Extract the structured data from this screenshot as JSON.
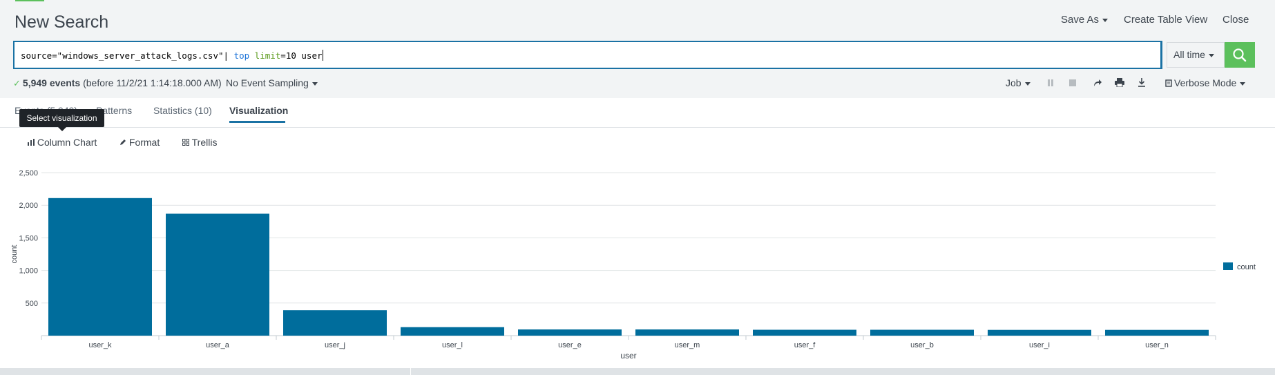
{
  "header": {
    "title": "New Search",
    "save_as": "Save As",
    "create_table_view": "Create Table View",
    "close": "Close"
  },
  "search": {
    "query_prefix": "source=\"windows_server_attack_logs.csv\"| ",
    "query_cmd": "top",
    "query_arg": " limit",
    "query_rest": "=10 user",
    "time_range": "All time",
    "search_icon": "magnifier-icon"
  },
  "status": {
    "count": "5,949 events",
    "before": "(before 11/2/21 1:14:18.000 AM)",
    "sampling": "No Event Sampling",
    "job": "Job",
    "mode": "Verbose Mode"
  },
  "tabs": {
    "events": "Events (5,949)",
    "patterns": "Patterns",
    "statistics": "Statistics (10)",
    "visualization": "Visualization"
  },
  "tooltip": "Select visualization",
  "viz_toolbar": {
    "chart_type": "Column Chart",
    "format": "Format",
    "trellis": "Trellis"
  },
  "colors": {
    "accent": "#1a72a4",
    "bar": "#006d9c",
    "search_button": "#5cc05c"
  },
  "chart_data": {
    "type": "bar",
    "categories": [
      "user_k",
      "user_a",
      "user_j",
      "user_l",
      "user_e",
      "user_m",
      "user_f",
      "user_b",
      "user_i",
      "user_n"
    ],
    "series": [
      {
        "name": "count",
        "values": [
          2110,
          1870,
          390,
          130,
          95,
          95,
          90,
          90,
          88,
          88
        ]
      }
    ],
    "xlabel": "user",
    "ylabel": "count",
    "ylim": [
      0,
      2500
    ],
    "yticks": [
      "500",
      "1,000",
      "1,500",
      "2,000",
      "2,500"
    ],
    "ytick_values": [
      500,
      1000,
      1500,
      2000,
      2500
    ],
    "grid": true,
    "legend": "right"
  }
}
